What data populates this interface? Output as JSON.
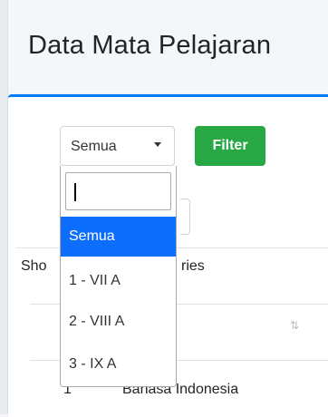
{
  "header": {
    "title": "Data Mata Pelajaran"
  },
  "filter": {
    "selected": "Semua",
    "button_label": "Filter"
  },
  "table_controls": {
    "show_label": "Sho",
    "entries_label": "ries"
  },
  "dropdown": {
    "search_value": "",
    "options": [
      {
        "label": "Semua",
        "selected": true
      },
      {
        "label": "1 - VII A"
      },
      {
        "label": "2 - VIII A"
      },
      {
        "label": "3 - IX A"
      }
    ]
  },
  "table": {
    "sort_icon": "⇅",
    "rows": [
      {
        "no": "1",
        "name": "Bahasa Indonesia"
      }
    ]
  },
  "colors": {
    "accent": "#007bff",
    "filter_button": "#28a745",
    "option_highlight": "#0d6efd"
  }
}
